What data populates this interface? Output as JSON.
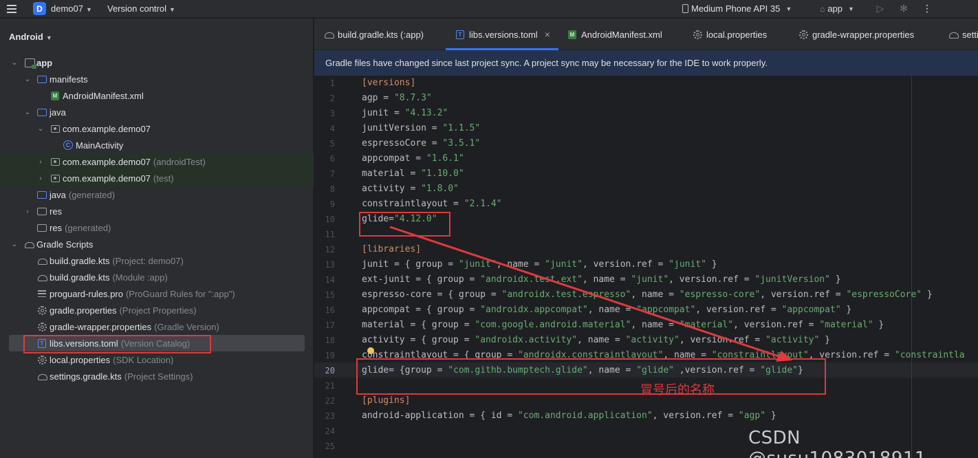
{
  "toolbar": {
    "project_letter": "D",
    "project_name": "demo07",
    "vcs_label": "Version control",
    "device": "Medium Phone API 35",
    "run_config": "app"
  },
  "project_panel": {
    "view_label": "Android",
    "items": [
      {
        "label": "app",
        "hint": ""
      },
      {
        "label": "manifests",
        "hint": ""
      },
      {
        "label": "AndroidManifest.xml",
        "hint": ""
      },
      {
        "label": "java",
        "hint": ""
      },
      {
        "label": "com.example.demo07",
        "hint": ""
      },
      {
        "label": "MainActivity",
        "hint": ""
      },
      {
        "label": "com.example.demo07",
        "hint": "(androidTest)"
      },
      {
        "label": "com.example.demo07",
        "hint": "(test)"
      },
      {
        "label": "java",
        "hint": "(generated)"
      },
      {
        "label": "res",
        "hint": ""
      },
      {
        "label": "res",
        "hint": "(generated)"
      },
      {
        "label": "Gradle Scripts",
        "hint": ""
      },
      {
        "label": "build.gradle.kts",
        "hint": "(Project: demo07)"
      },
      {
        "label": "build.gradle.kts",
        "hint": "(Module :app)"
      },
      {
        "label": "proguard-rules.pro",
        "hint": "(ProGuard Rules for \":app\")"
      },
      {
        "label": "gradle.properties",
        "hint": "(Project Properties)"
      },
      {
        "label": "gradle-wrapper.properties",
        "hint": "(Gradle Version)"
      },
      {
        "label": "libs.versions.toml",
        "hint": "(Version Catalog)"
      },
      {
        "label": "local.properties",
        "hint": "(SDK Location)"
      },
      {
        "label": "settings.gradle.kts",
        "hint": "(Project Settings)"
      }
    ]
  },
  "editor": {
    "tabs": [
      {
        "label": "build.gradle.kts (:app)"
      },
      {
        "label": "libs.versions.toml"
      },
      {
        "label": "AndroidManifest.xml"
      },
      {
        "label": "local.properties"
      },
      {
        "label": "gradle-wrapper.properties"
      },
      {
        "label": "setti"
      }
    ],
    "banner": "Gradle files have changed since last project sync. A project sync may be necessary for the IDE to work properly.",
    "line_numbers": [
      "1",
      "2",
      "3",
      "4",
      "5",
      "6",
      "7",
      "8",
      "9",
      "10",
      "11",
      "12",
      "13",
      "14",
      "15",
      "16",
      "17",
      "18",
      "19",
      "20",
      "21",
      "22",
      "23",
      "24",
      "25"
    ],
    "code_lines": [
      "[versions]",
      "agp = \"8.7.3\"",
      "junit = \"4.13.2\"",
      "junitVersion = \"1.1.5\"",
      "espressoCore = \"3.5.1\"",
      "appcompat = \"1.6.1\"",
      "material = \"1.10.0\"",
      "activity = \"1.8.0\"",
      "constraintlayout = \"2.1.4\"",
      "glide=\"4.12.0\"",
      "",
      "[libraries]",
      "junit = { group = \"junit\", name = \"junit\", version.ref = \"junit\" }",
      "ext-junit = { group = \"androidx.test.ext\", name = \"junit\", version.ref = \"junitVersion\" }",
      "espresso-core = { group = \"androidx.test.espresso\", name = \"espresso-core\", version.ref = \"espressoCore\" }",
      "appcompat = { group = \"androidx.appcompat\", name = \"appcompat\", version.ref = \"appcompat\" }",
      "material = { group = \"com.google.android.material\", name = \"material\", version.ref = \"material\" }",
      "activity = { group = \"androidx.activity\", name = \"activity\", version.ref = \"activity\" }",
      "constraintlayout = { group = \"androidx.constraintlayout\", name = \"constraintlayout\", version.ref = \"constraintla",
      "glide= {group = \"com.githb.bumptech.glide\", name = \"glide\" ,version.ref = \"glide\"}",
      "",
      "[plugins]",
      "android-application = { id = \"com.android.application\", version.ref = \"agp\" }",
      "",
      ""
    ],
    "current_line": "20"
  },
  "annotation": "冒号后的名称",
  "watermark": "CSDN @susu1083018911",
  "colors": {
    "accent": "#3574f0",
    "annotation_red": "#e0393e",
    "string_green": "#6aab73"
  }
}
